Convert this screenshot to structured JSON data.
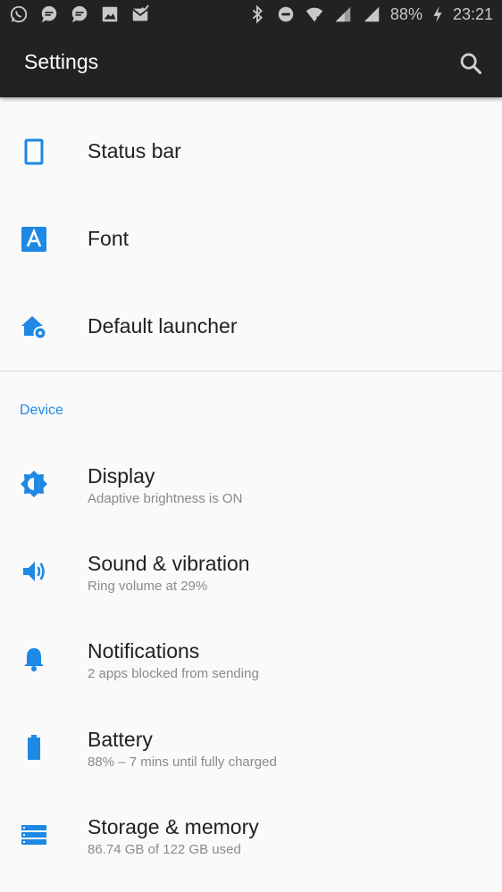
{
  "status_bar": {
    "battery_text": "88%",
    "time": "23:21"
  },
  "app_bar": {
    "title": "Settings"
  },
  "colors": {
    "accent": "#1e88e5",
    "appbar": "#222222",
    "background": "#fafafa"
  },
  "top_items": [
    {
      "title": "Status bar",
      "icon": "phone-outline-icon"
    },
    {
      "title": "Font",
      "icon": "font-a-icon"
    },
    {
      "title": "Default launcher",
      "icon": "home-gear-icon"
    }
  ],
  "device_section": {
    "header": "Device",
    "items": [
      {
        "title": "Display",
        "summary": "Adaptive brightness is ON",
        "icon": "brightness-icon"
      },
      {
        "title": "Sound & vibration",
        "summary": "Ring volume at 29%",
        "icon": "volume-icon"
      },
      {
        "title": "Notifications",
        "summary": "2 apps blocked from sending",
        "icon": "bell-icon"
      },
      {
        "title": "Battery",
        "summary": "88% – 7 mins until fully charged",
        "icon": "battery-icon"
      },
      {
        "title": "Storage & memory",
        "summary": "86.74 GB of 122 GB used",
        "icon": "storage-icon"
      }
    ]
  }
}
